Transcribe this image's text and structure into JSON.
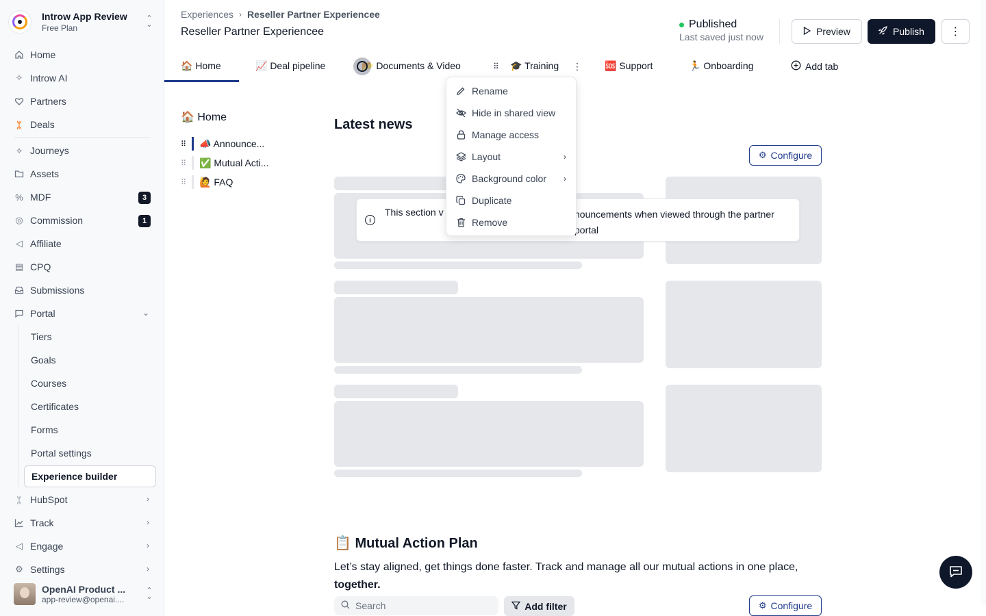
{
  "workspace": {
    "name": "Introw App Review",
    "plan": "Free Plan"
  },
  "nav": {
    "home": "Home",
    "introw_ai": "Introw AI",
    "partners": "Partners",
    "deals": "Deals",
    "journeys": "Journeys",
    "assets": "Assets",
    "mdf": "MDF",
    "mdf_badge": "3",
    "commission": "Commission",
    "commission_badge": "1",
    "affiliate": "Affiliate",
    "cpq": "CPQ",
    "submissions": "Submissions",
    "portal": "Portal",
    "portal_sub": [
      "Tiers",
      "Goals",
      "Courses",
      "Certificates",
      "Forms",
      "Portal settings",
      "Experience builder"
    ],
    "hubspot": "HubSpot",
    "track": "Track",
    "engage": "Engage",
    "settings": "Settings"
  },
  "user": {
    "name": "OpenAI Product ...",
    "email": "app-review@openai...."
  },
  "header": {
    "breadcrumb_root": "Experiences",
    "breadcrumb_current": "Reseller Partner Experiencee",
    "title": "Reseller Partner Experiencee",
    "status": "Published",
    "saved": "Last saved just now",
    "preview": "Preview",
    "publish": "Publish"
  },
  "tabs": [
    {
      "label": "🏠 Home"
    },
    {
      "label": "📈 Deal pipeline"
    },
    {
      "label": "📂 Documents & Video"
    },
    {
      "label": "🎓 Training"
    },
    {
      "label": "🆘 Support"
    },
    {
      "label": "🏃 Onboarding"
    },
    {
      "label": "Add tab"
    }
  ],
  "outline": {
    "title": "🏠 Home",
    "items": [
      "📣 Announce...",
      "✅ Mutual Acti...",
      "🙋 FAQ"
    ]
  },
  "content": {
    "news_heading": "Latest news",
    "configure": "Configure",
    "info_left": "This section v",
    "info_right": "nouncements when viewed through the partner portal",
    "map_heading": "📋 Mutual Action Plan",
    "map_desc": "Let’s stay aligned, get things done faster. Track and manage all our mutual actions in one place,",
    "map_desc_bold": "together.",
    "search_placeholder": "Search",
    "add_filter": "Add filter"
  },
  "context_menu": {
    "items": [
      "Rename",
      "Hide in shared view",
      "Manage access",
      "Layout",
      "Background color",
      "Duplicate",
      "Remove"
    ]
  },
  "colors": {
    "accent": "#1e3a8a",
    "primary_button": "#0f172a",
    "status_green": "#22c55e",
    "skeleton": "#e5e7eb"
  }
}
